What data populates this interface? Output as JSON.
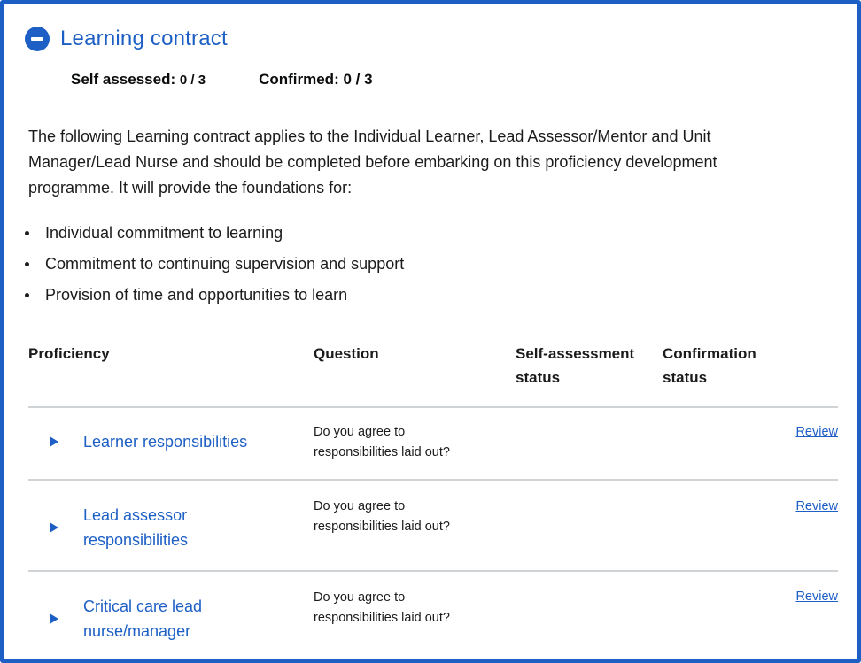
{
  "section": {
    "title": "Learning contract",
    "toggle_icon": "minus-circle-icon",
    "accent_color": "#1d5fc4"
  },
  "counts": {
    "self_assessed_label": "Self assessed:",
    "self_assessed_value": "0 / 3",
    "confirmed_label": "Confirmed:",
    "confirmed_value": "0 / 3"
  },
  "intro": {
    "line1": "The following Learning contract applies to the Individual Learner, Lead Assessor/Mentor and Unit",
    "line2": "Manager/Lead Nurse and should be completed before embarking on this proficiency development",
    "line3": "programme. It will provide the foundations for:"
  },
  "bullets": [
    "Individual commitment to learning",
    "Commitment to continuing supervision and support",
    "Provision of time and opportunities to learn"
  ],
  "table": {
    "headers": {
      "proficiency": "Proficiency",
      "question": "Question",
      "self_assessment_1": "Self-assessment",
      "self_assessment_2": "status",
      "confirmation_1": "Confirmation",
      "confirmation_2": "status"
    },
    "rows": [
      {
        "prof_line1": "Learner responsibilities",
        "prof_line2": "",
        "question_line1": "Do you agree to",
        "question_line2": "responsibilities laid out?",
        "action": "Review"
      },
      {
        "prof_line1": "Lead assessor",
        "prof_line2": "responsibilities",
        "question_line1": "Do you agree to",
        "question_line2": "responsibilities laid out?",
        "action": "Review"
      },
      {
        "prof_line1": "Critical care lead",
        "prof_line2": "nurse/manager",
        "question_line1": "Do you agree to",
        "question_line2": "responsibilities laid out?",
        "action": "Review"
      }
    ]
  }
}
